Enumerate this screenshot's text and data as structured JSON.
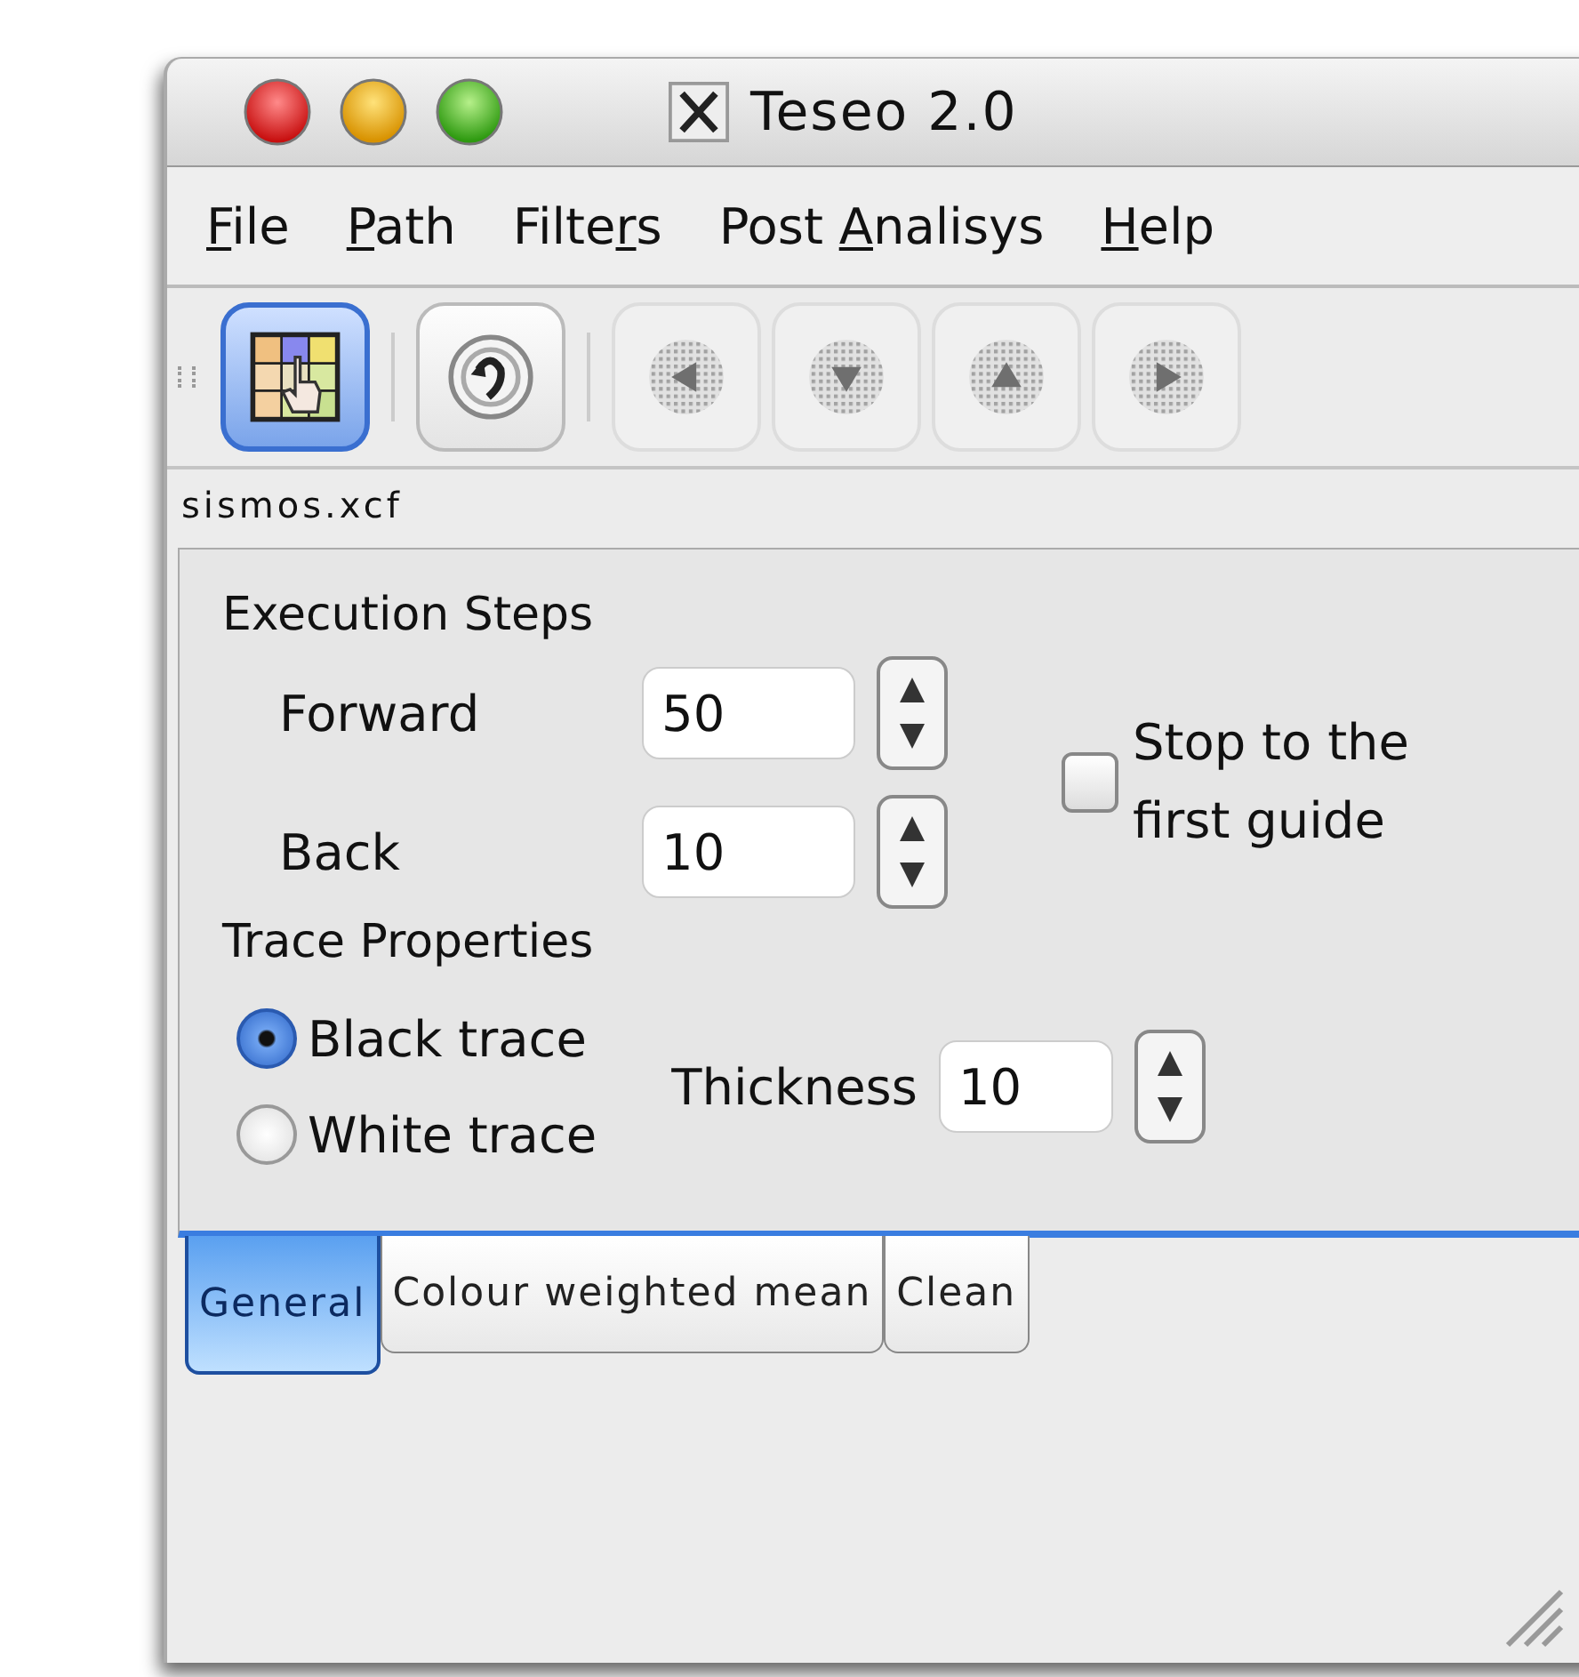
{
  "window": {
    "title": "Teseo 2.0"
  },
  "menu": [
    {
      "key": "F",
      "post": "ile"
    },
    {
      "key": "P",
      "post": "ath"
    },
    {
      "pre": "Filte",
      "key": "r",
      "post": "s"
    },
    {
      "pre": "Post ",
      "key": "A",
      "post": "nalisys"
    },
    {
      "key": "H",
      "post": "elp"
    }
  ],
  "toolbar": [
    {
      "kind": "grid",
      "selected": true,
      "disabled": false
    },
    {
      "kind": "undo",
      "selected": false,
      "disabled": false
    },
    {
      "kind": "left",
      "selected": false,
      "disabled": true
    },
    {
      "kind": "down",
      "selected": false,
      "disabled": true
    },
    {
      "kind": "up",
      "selected": false,
      "disabled": true
    },
    {
      "kind": "right",
      "selected": false,
      "disabled": true
    }
  ],
  "file_name": "sismos.xcf",
  "execution_steps": {
    "title": "Execution Steps",
    "fields": [
      {
        "label": "Forward",
        "value": "50"
      },
      {
        "label": "Back",
        "value": "10"
      }
    ],
    "stop_checkbox": {
      "label": "Stop to the first guide",
      "checked": false
    }
  },
  "trace_properties": {
    "title": "Trace Properties",
    "radios": [
      {
        "label": "Black trace",
        "selected": true
      },
      {
        "label": "White trace",
        "selected": false
      }
    ],
    "thickness": {
      "label": "Thickness",
      "value": "10"
    }
  },
  "tabs": [
    {
      "label": "General",
      "selected": true
    },
    {
      "label": "Colour weighted mean",
      "selected": false
    },
    {
      "label": "Clean",
      "selected": false
    }
  ]
}
